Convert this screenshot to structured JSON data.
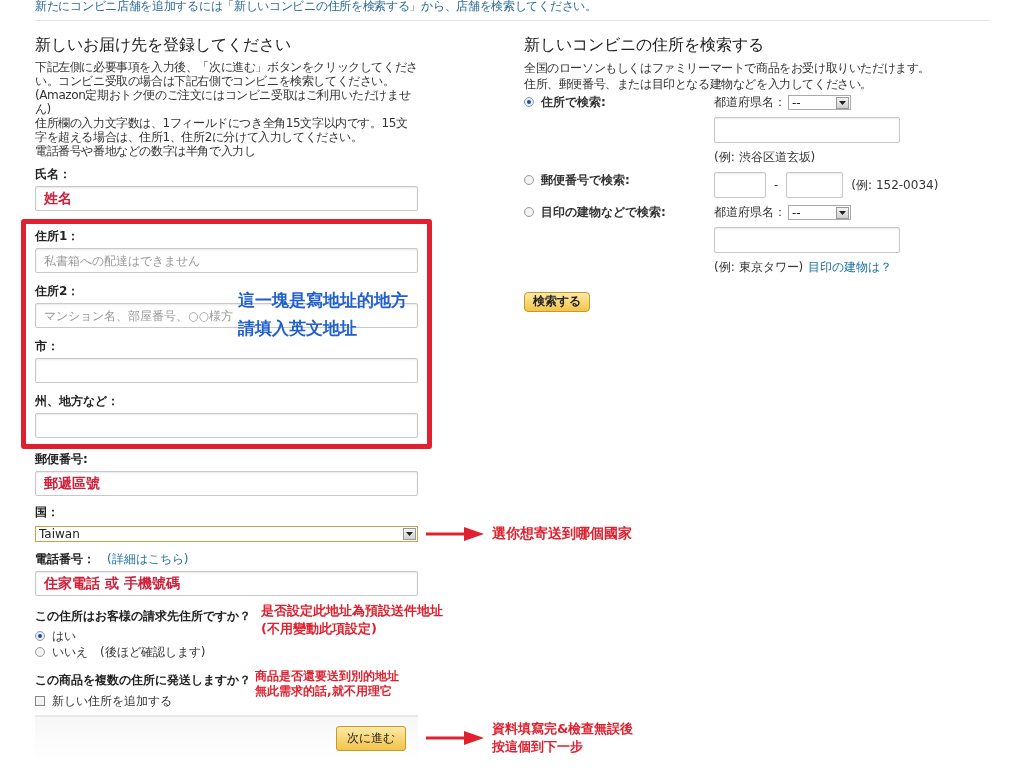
{
  "top_notice": "新たにコンビニ店舗を追加するには「新しいコンビニの住所を検索する」から、店舗を検索してください。",
  "address_form": {
    "title": "新しいお届け先を登録してください",
    "instructions": [
      "下記左側に必要事項を入力後、「次に進む」ボタンをクリックしてください。コンビニ受取の場合は下記右側でコンビニを検索してください。(Amazon定期おトク便のご注文にはコンビニ受取はご利用いただけません)",
      "住所欄の入力文字数は、1フィールドにつき全角15文字以内です。15文字を超える場合は、住所1、住所2に分けて入力してください。",
      "電話番号や番地などの数字は半角で入力し"
    ],
    "name_field": {
      "label": "氏名：",
      "value": "姓名"
    },
    "address_group": {
      "fields": [
        {
          "label": "住所1：",
          "placeholder": "私書箱への配達はできません"
        },
        {
          "label": "住所2：",
          "placeholder": "マンション名、部屋番号、○○様方"
        },
        {
          "label": "市："
        },
        {
          "label": "州、地方など："
        }
      ],
      "annotation": [
        "這一塊是寫地址的地方",
        "請填入英文地址"
      ]
    },
    "postal_field": {
      "label": "郵便番号:",
      "value": "郵遞區號"
    },
    "country_field": {
      "label": "国：",
      "value": "Taiwan",
      "annotation": "選你想寄送到哪個國家"
    },
    "phone_field": {
      "label": "電話番号：",
      "link": "(詳細はこちら)",
      "value": "住家電話 或 手機號碼"
    },
    "billing_question": {
      "question": "この住所はお客様の請求先住所ですか？",
      "options": [
        {
          "label": "はい",
          "selected": true
        },
        {
          "label": "いいえ　(後ほど確認します)",
          "selected": false
        }
      ],
      "annotation": [
        "是否設定此地址為預設送件地址",
        "(不用變動此項設定)"
      ]
    },
    "multi_question": {
      "question": "この商品を複数の住所に発送しますか？",
      "checkbox": {
        "label": "新しい住所を追加する",
        "checked": false
      },
      "annotation": [
        "商品是否還要送到別的地址",
        "無此需求的話,就不用理它"
      ]
    },
    "next_button": {
      "label": "次に進む",
      "annotation": [
        "資料填寫完&檢查無誤後",
        "按這個到下一步"
      ]
    }
  },
  "store_search": {
    "title": "新しいコンビニの住所を検索する",
    "lines": [
      "全国のローソンもしくはファミリーマートで商品をお受け取りいただけます。",
      "住所、郵便番号、または目印となる建物などを入力してください。"
    ],
    "options": [
      {
        "kind": "address",
        "label": "住所で検索:",
        "selected": true,
        "prefecture_label": "都道府県名：",
        "prefecture_value": "--",
        "example": "(例: 渋谷区道玄坂)"
      },
      {
        "kind": "postal",
        "label": "郵便番号で検索:",
        "selected": false,
        "separator": "-",
        "example": "(例: 152-0034)"
      },
      {
        "kind": "landmark",
        "label": "目印の建物などで検索:",
        "selected": false,
        "prefecture_label": "都道府県名：",
        "prefecture_value": "--",
        "example": "(例: 東京タワー)",
        "help_link": "目印の建物は？"
      }
    ],
    "button": "検索する"
  }
}
